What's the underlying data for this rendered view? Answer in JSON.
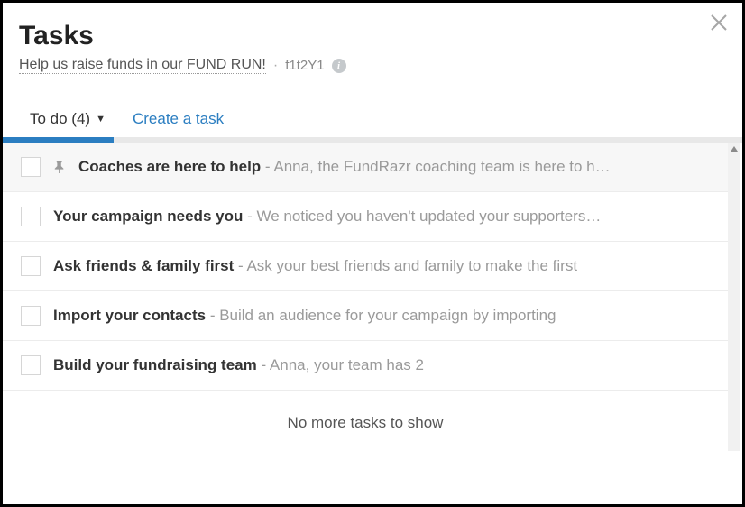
{
  "header": {
    "title": "Tasks",
    "subtitle": "Help us raise funds in our FUND RUN!",
    "code": "f1t2Y1"
  },
  "tabs": {
    "todo_label": "To do (4)",
    "create_label": "Create a task"
  },
  "progress": {
    "percent": 15
  },
  "tasks": [
    {
      "pinned": true,
      "title": "Coaches are here to help",
      "preview": "Anna, the FundRazr coaching team is here to h…"
    },
    {
      "pinned": false,
      "title": "Your campaign needs you",
      "preview": "We noticed you haven't updated your supporters…"
    },
    {
      "pinned": false,
      "title": "Ask friends & family first",
      "preview": "Ask your best friends and family to make the first"
    },
    {
      "pinned": false,
      "title": "Import your contacts",
      "preview": "Build an audience for your campaign by importing"
    },
    {
      "pinned": false,
      "title": "Build your fundraising team",
      "preview": "Anna, your team has 2"
    }
  ],
  "footer": {
    "no_more": "No more tasks to show"
  }
}
